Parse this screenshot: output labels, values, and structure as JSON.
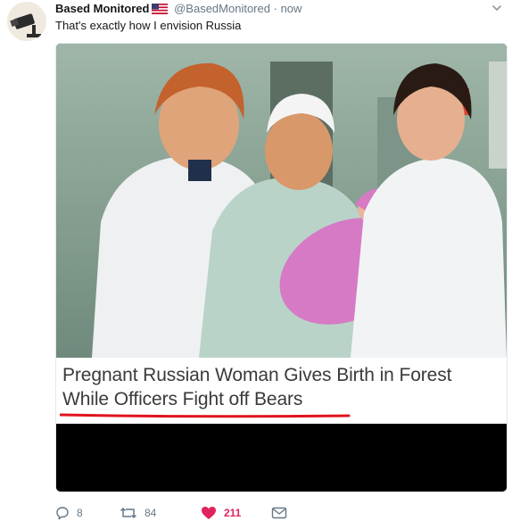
{
  "tweet": {
    "author_name": "Based Monitored",
    "author_handle": "@BasedMonitored",
    "separator": "·",
    "timestamp": "now",
    "text": "That's exactly how I envision Russia"
  },
  "media": {
    "headline_line1": "Pregnant Russian Woman Gives Birth in Forest",
    "headline_line2": "While Officers Fight off Bears",
    "underline_color": "#e0141e"
  },
  "actions": {
    "reply_count": "8",
    "retweet_count": "84",
    "like_count": "211",
    "like_color": "#e0245e"
  },
  "icons": [
    "avatar-camera",
    "us-flag-icon",
    "chevron-down-icon",
    "reply-icon",
    "retweet-icon",
    "heart-icon",
    "message-icon"
  ]
}
